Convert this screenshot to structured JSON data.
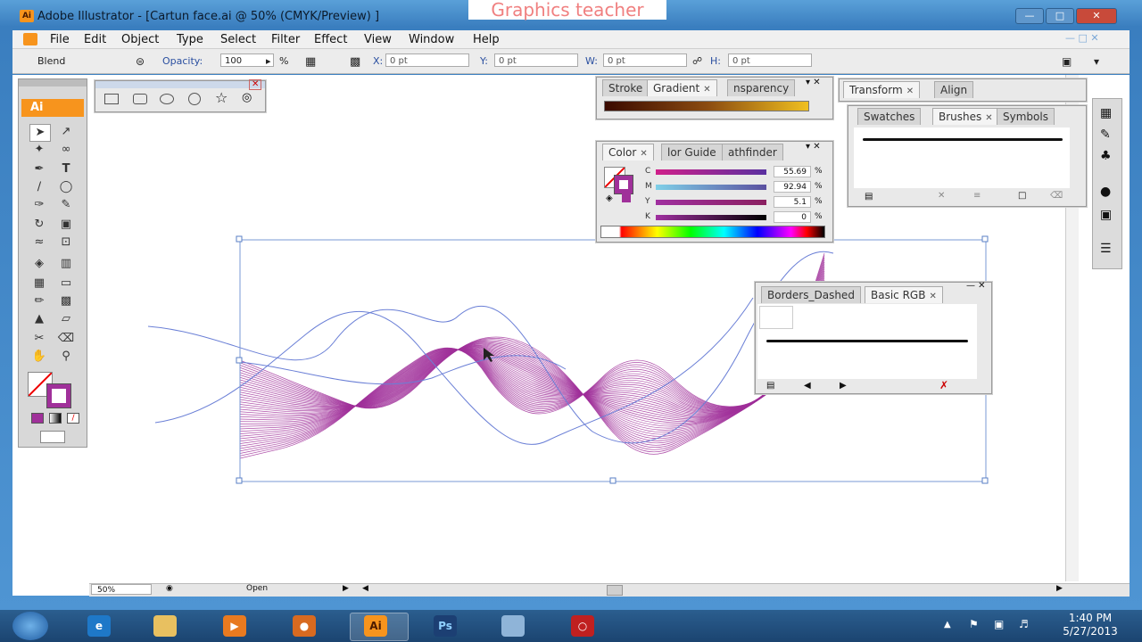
{
  "window": {
    "title": "Adobe Illustrator - [Cartun face.ai @ 50% (CMYK/Preview) ]",
    "app_badge": "Ai",
    "watermark": "Graphics teacher"
  },
  "menu": [
    "File",
    "Edit",
    "Object",
    "Type",
    "Select",
    "Filter",
    "Effect",
    "View",
    "Window",
    "Help"
  ],
  "control_bar": {
    "mode": "Blend",
    "opacity_label": "Opacity:",
    "opacity_value": "100",
    "opacity_unit": "%",
    "x_label": "X:",
    "x_value": "0 pt",
    "y_label": "Y:",
    "y_value": "0 pt",
    "w_label": "W:",
    "w_value": "0 pt",
    "h_label": "H:",
    "h_value": "0 pt"
  },
  "tools_badge": "Ai",
  "panels": {
    "stroke_group": {
      "tabs": [
        "Stroke",
        "Gradient",
        "nsparency"
      ]
    },
    "color_group": {
      "tabs": [
        "Color",
        "lor Guide",
        "athfinder"
      ],
      "channels": [
        {
          "label": "C",
          "value": "55.69",
          "unit": "%"
        },
        {
          "label": "M",
          "value": "92.94",
          "unit": "%"
        },
        {
          "label": "Y",
          "value": "5.1",
          "unit": "%"
        },
        {
          "label": "K",
          "value": "0",
          "unit": "%"
        }
      ]
    },
    "transform_group": {
      "tabs": [
        "Transform",
        "Align"
      ]
    },
    "swatches_group": {
      "tabs": [
        "Swatches",
        "Brushes",
        "Symbols"
      ]
    },
    "brush_library": {
      "tabs": [
        "Borders_Dashed",
        "Basic RGB"
      ]
    }
  },
  "status": {
    "zoom": "50%",
    "state": "Open"
  },
  "taskbar": {
    "apps": [
      "Ai",
      "Ps"
    ],
    "time": "1:40 PM",
    "date": "5/27/2013"
  },
  "colors": {
    "accent_orange": "#f7941d",
    "blend_purple": "#a0309a",
    "path_blue": "#6a7fd6"
  }
}
